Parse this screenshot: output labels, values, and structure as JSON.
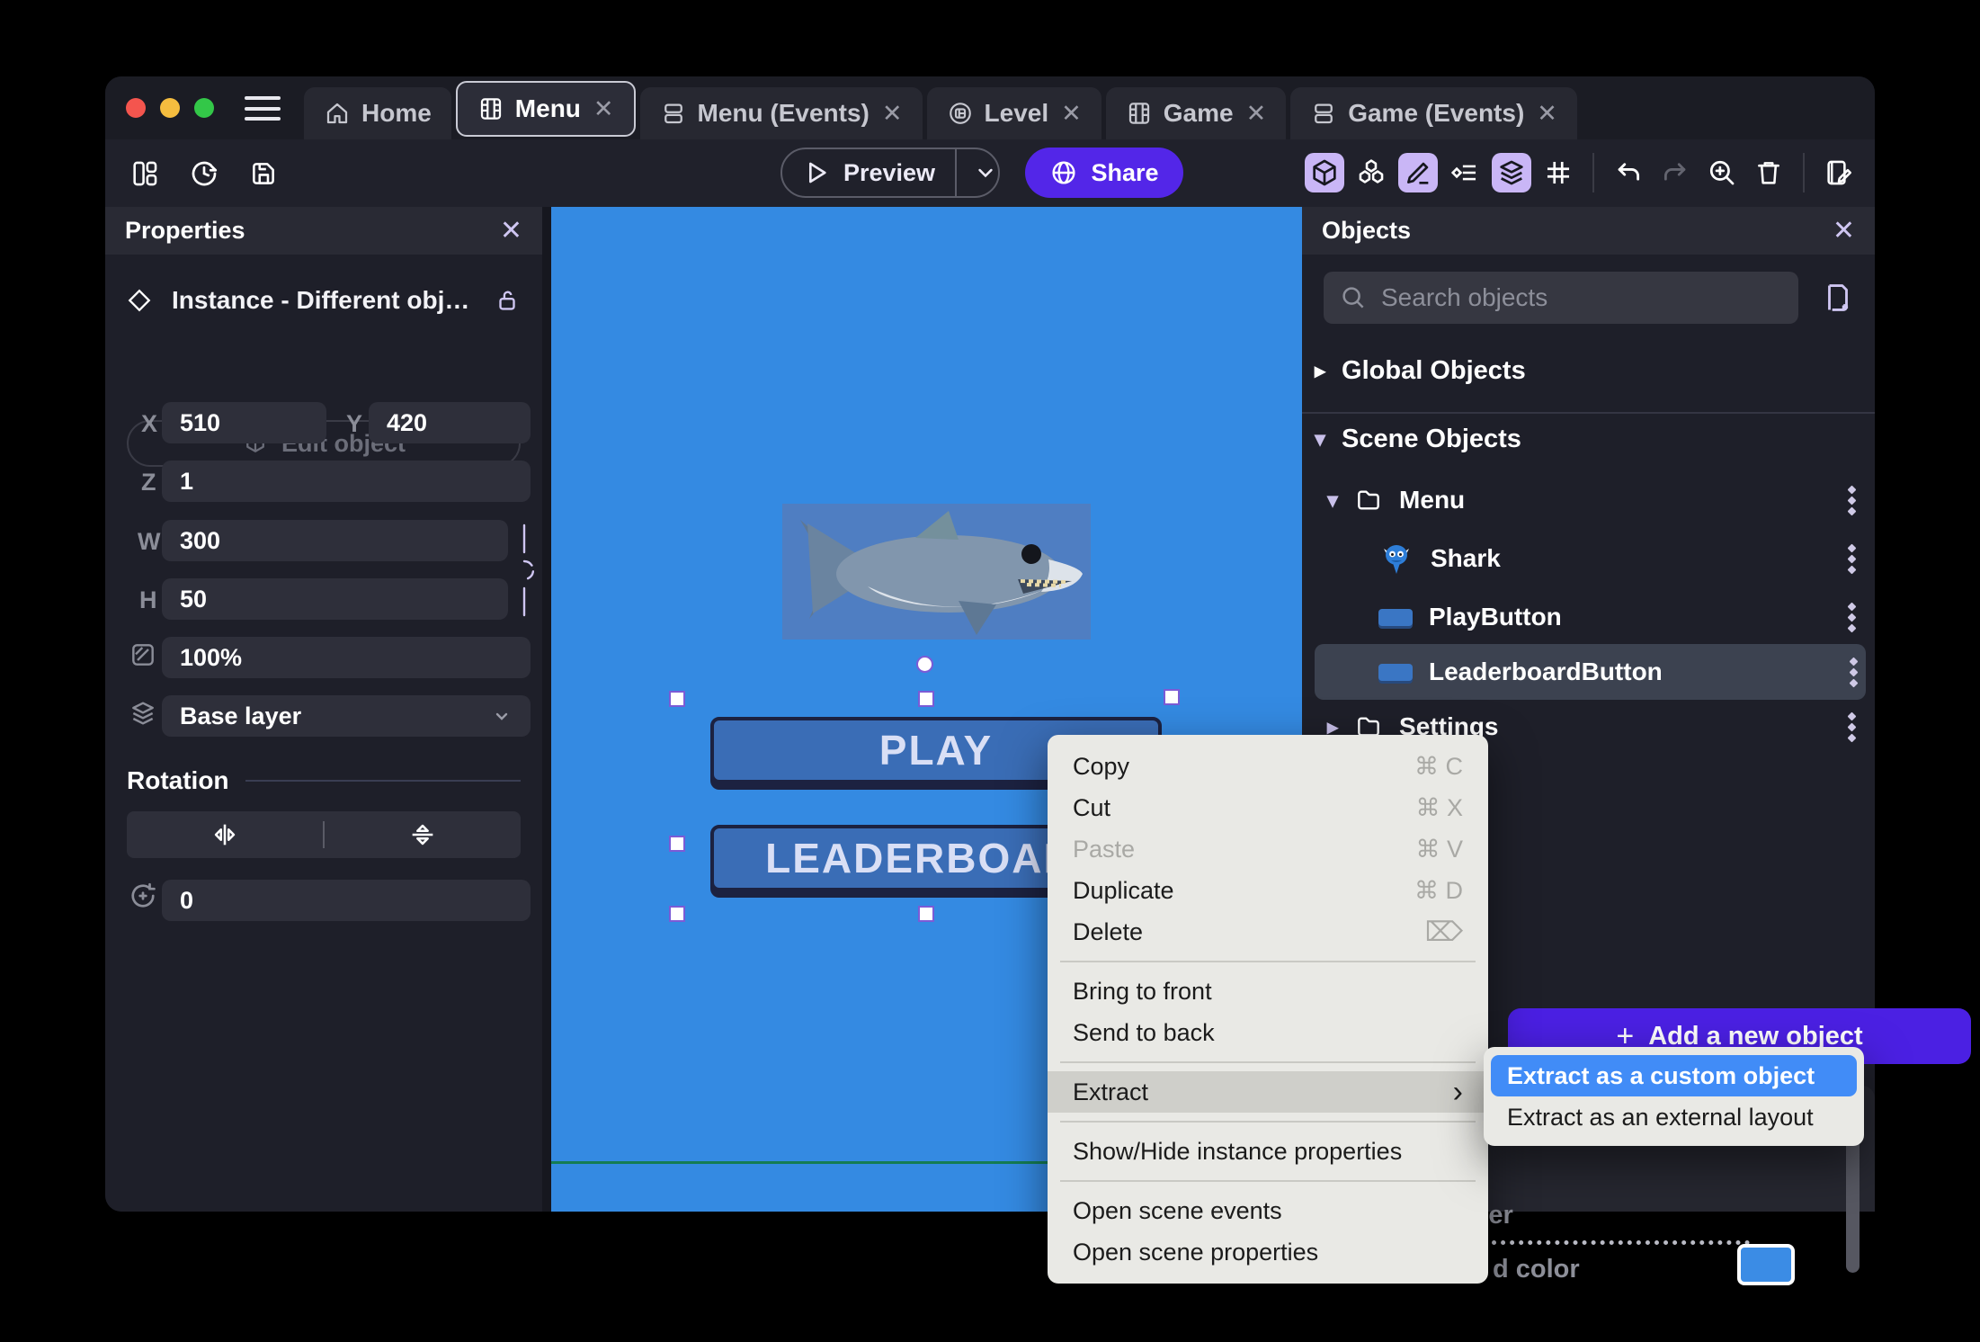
{
  "tabs": [
    {
      "label": "Home",
      "close": ""
    },
    {
      "label": "Menu",
      "close": "✕"
    },
    {
      "label": "Menu (Events)",
      "close": "✕"
    },
    {
      "label": "Level",
      "close": "✕"
    },
    {
      "label": "Game",
      "close": "✕"
    },
    {
      "label": "Game (Events)",
      "close": "✕"
    }
  ],
  "toolbar": {
    "preview_label": "Preview",
    "share_label": "Share"
  },
  "properties": {
    "title": "Properties",
    "close": "✕",
    "instance_text": "Instance  -  Different obj…",
    "edit_object_label": "Edit object",
    "x_label": "X",
    "x_value": "510",
    "y_label": "Y",
    "y_value": "420",
    "z_label": "Z",
    "z_value": "1",
    "w_label": "W",
    "w_value": "300",
    "h_label": "H",
    "h_value": "50",
    "opacity_value": "100%",
    "layer_value": "Base layer",
    "rotation_title": "Rotation",
    "rotation_value": "0"
  },
  "canvas": {
    "play_label": "PLAY",
    "leaderboard_label": "LEADERBOARD"
  },
  "objects": {
    "title": "Objects",
    "close": "✕",
    "search_placeholder": "Search objects",
    "global_label": "Global Objects",
    "scene_label": "Scene Objects",
    "tree": [
      {
        "label": "Menu"
      },
      {
        "label": "Shark"
      },
      {
        "label": "PlayButton"
      },
      {
        "label": "LeaderboardButton"
      },
      {
        "label": "Settings"
      }
    ],
    "add_label": "Add a new object",
    "subpanel_close": "✕",
    "layer_fragment": "layer",
    "color_fragment": "d color"
  },
  "context_menu": {
    "items": [
      {
        "label": "Copy",
        "shortcut": "⌘ C"
      },
      {
        "label": "Cut",
        "shortcut": "⌘ X"
      },
      {
        "label": "Paste",
        "shortcut": "⌘ V"
      },
      {
        "label": "Duplicate",
        "shortcut": "⌘ D"
      },
      {
        "label": "Delete",
        "shortcut": "⌦"
      },
      {
        "label": "Bring to front"
      },
      {
        "label": "Send to back"
      },
      {
        "label": "Extract",
        "arrow": "›"
      },
      {
        "label": "Show/Hide instance properties"
      },
      {
        "label": "Open scene events"
      },
      {
        "label": "Open scene properties"
      }
    ]
  },
  "submenu": {
    "items": [
      {
        "label": "Extract as a custom object"
      },
      {
        "label": "Extract as an external layout"
      }
    ]
  },
  "colors": {
    "accent_purple": "#5326e8",
    "add_button_purple": "#4b20e3",
    "canvas_blue": "#348ae2",
    "submenu_selection_blue": "#418cf7",
    "toggle_active_lavender": "#c9b6f6",
    "selection_handle_purple": "#7b5bd6",
    "guide_green": "#157c53",
    "traffic_red": "#f4554e",
    "traffic_yellow": "#f5bd3f",
    "traffic_green": "#33c748"
  }
}
